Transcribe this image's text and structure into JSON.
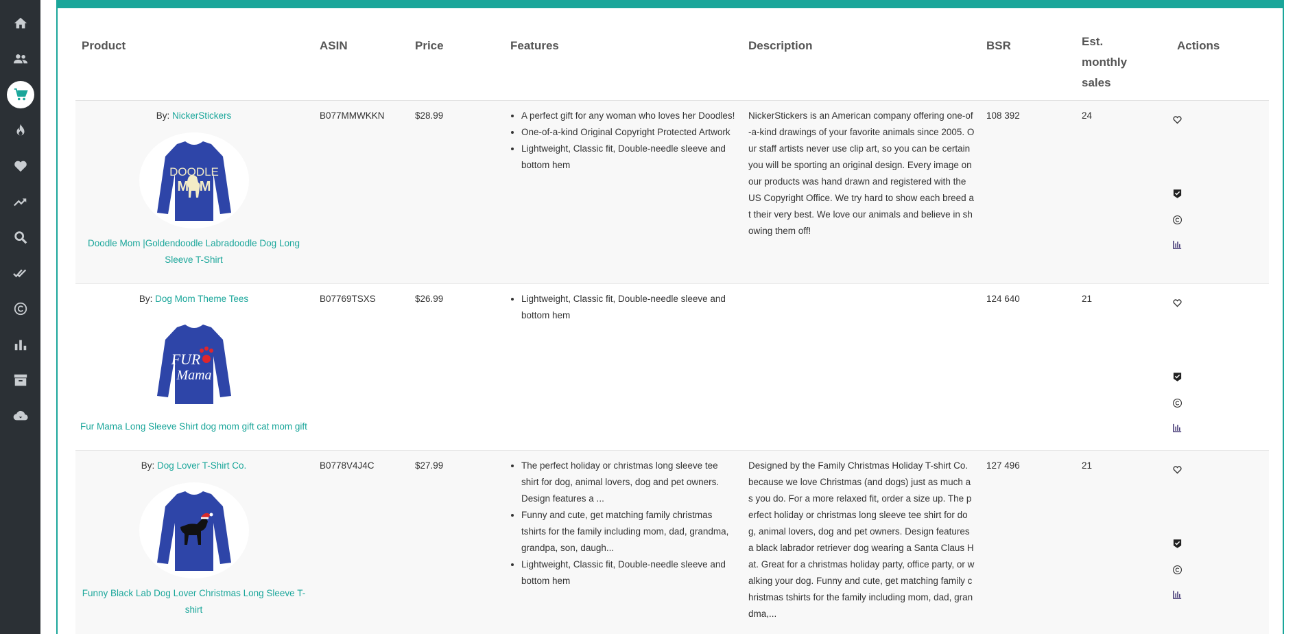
{
  "sidebar": {
    "items": [
      {
        "icon": "home-icon",
        "active": false
      },
      {
        "icon": "users-icon",
        "active": false
      },
      {
        "icon": "cart-icon",
        "active": true
      },
      {
        "icon": "fire-icon",
        "active": false
      },
      {
        "icon": "heart-icon",
        "active": false
      },
      {
        "icon": "trending-icon",
        "active": false
      },
      {
        "icon": "search-icon",
        "active": false
      },
      {
        "icon": "double-check-icon",
        "active": false
      },
      {
        "icon": "copyright-icon",
        "active": false
      },
      {
        "icon": "bar-chart-icon",
        "active": false
      },
      {
        "icon": "archive-icon",
        "active": false
      },
      {
        "icon": "cloud-download-icon",
        "active": false
      }
    ]
  },
  "table": {
    "headers": {
      "product": "Product",
      "asin": "ASIN",
      "price": "Price",
      "features": "Features",
      "description": "Description",
      "bsr": "BSR",
      "sales_line1": "Est.",
      "sales_line2": "monthly",
      "sales_line3": "sales",
      "actions": "Actions"
    },
    "rows": [
      {
        "by_prefix": "By:",
        "brand": "NickerStickers",
        "shirt_text_line1": "DOODLE",
        "shirt_text_line2": "MOM",
        "title": "Doodle Mom |Goldendoodle Labradoodle Dog Long Sleeve T-Shirt",
        "asin": "B077MMWKKN",
        "price": "$28.99",
        "features": [
          "A perfect gift for any woman who loves her Doodles!",
          "One-of-a-kind Original Copyright Protected Artwork",
          "Lightweight, Classic fit, Double-needle sleeve and bottom hem"
        ],
        "description": "NickerStickers is an American company offering one-of-a-kind drawings of your favorite animals since 2005. Our staff artists never use clip art, so you can be certain you will be sporting an original design. Every image on our products was hand drawn and registered with the US Copyright Office. We try hard to show each breed at their very best. We love our animals and believe in showing them off!",
        "bsr": "108 392",
        "sales": "24"
      },
      {
        "by_prefix": "By:",
        "brand": "Dog Mom Theme Tees",
        "shirt_text_line1": "FUR",
        "shirt_text_line2": "Mama",
        "title": "Fur Mama Long Sleeve Shirt dog mom gift cat mom gift",
        "asin": "B07769TSXS",
        "price": "$26.99",
        "features": [
          "Lightweight, Classic fit, Double-needle sleeve and bottom hem"
        ],
        "description": "",
        "bsr": "124 640",
        "sales": "21"
      },
      {
        "by_prefix": "By:",
        "brand": "Dog Lover T-Shirt Co.",
        "shirt_text_line1": "",
        "shirt_text_line2": "",
        "title": "Funny Black Lab Dog Lover Christmas Long Sleeve T-shirt",
        "asin": "B0778V4J4C",
        "price": "$27.99",
        "features": [
          "The perfect holiday or christmas long sleeve tee shirt for dog, animal lovers, dog and pet owners. Design features a ...",
          "Funny and cute, get matching family christmas tshirts for the family including mom, dad, grandma, grandpa, son, daugh...",
          "Lightweight, Classic fit, Double-needle sleeve and bottom hem"
        ],
        "description": "Designed by the Family Christmas Holiday T-shirt Co. because we love Christmas (and dogs) just as much as you do. For a more relaxed fit, order a size up. The perfect holiday or christmas long sleeve tee shirt for dog, animal lovers, dog and pet owners. Design features a black labrador retriever dog wearing a Santa Claus Hat. Great for a christmas holiday party, office party, or walking your dog. Funny and cute, get matching family christmas tshirts for the family including mom, dad, grandma,...",
        "bsr": "127 496",
        "sales": "21"
      }
    ]
  },
  "colors": {
    "accent": "#1aa69a",
    "sidebar": "#2b3035",
    "shirt": "#2e45a8"
  }
}
